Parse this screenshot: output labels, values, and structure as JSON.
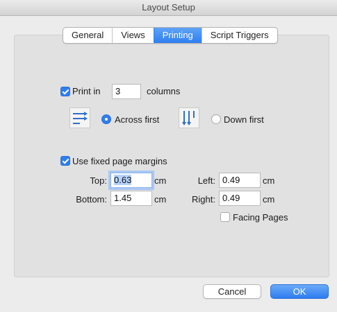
{
  "window": {
    "title": "Layout Setup"
  },
  "tabs": [
    {
      "label": "General"
    },
    {
      "label": "Views"
    },
    {
      "label": "Printing"
    },
    {
      "label": "Script Triggers"
    }
  ],
  "print_columns": {
    "checkbox_label": "Print in",
    "checked": true,
    "value": "3",
    "suffix": "columns",
    "across_label": "Across first",
    "down_label": "Down first",
    "selected": "Across first"
  },
  "margins": {
    "checkbox_label": "Use fixed page margins",
    "checked": true,
    "top_label": "Top:",
    "top_value": "0.63",
    "bottom_label": "Bottom:",
    "bottom_value": "1.45",
    "left_label": "Left:",
    "left_value": "0.49",
    "right_label": "Right:",
    "right_value": "0.49",
    "unit": "cm"
  },
  "facing_pages": {
    "label": "Facing Pages",
    "checked": false
  },
  "buttons": {
    "cancel": "Cancel",
    "ok": "OK"
  },
  "colors": {
    "accent": "#2f7ef0",
    "panel": "#e1e1e1",
    "window": "#ececec"
  }
}
